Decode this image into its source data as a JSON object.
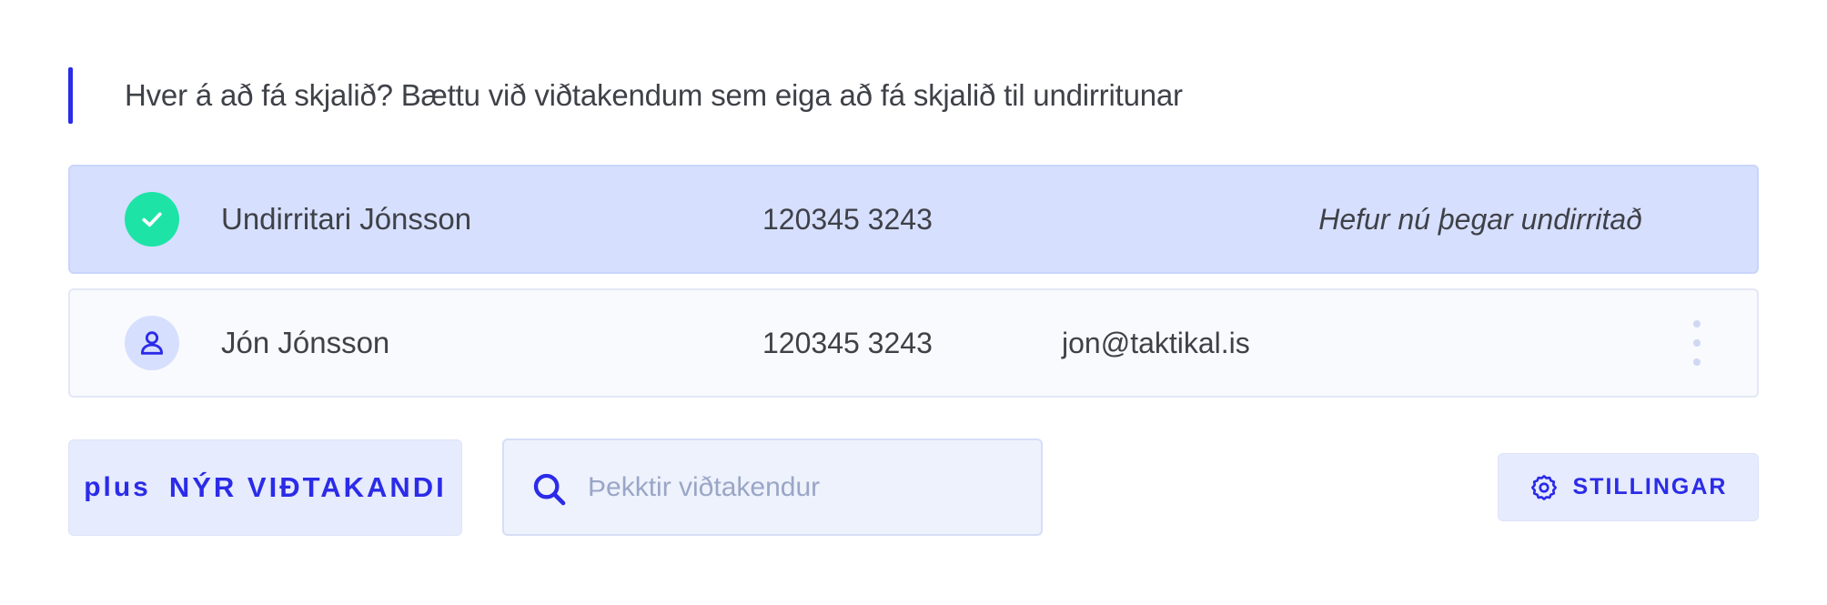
{
  "intro": {
    "text": "Hver á að fá skjalið? Bættu við viðtakendum sem eiga að fá skjalið til undirritunar"
  },
  "recipients": [
    {
      "name": "Undirritari Jónsson",
      "ssn": "120345 3243",
      "status": "Hefur nú þegar undirritað",
      "icon": "check-icon",
      "signed": true
    },
    {
      "name": "Jón Jónsson",
      "ssn": "120345 3243",
      "email": "jon@taktikal.is",
      "icon": "user-icon",
      "signed": false
    }
  ],
  "actions": {
    "add_label": "NÝR VIÐTAKANDI",
    "add_icon": "plus",
    "search_placeholder": "Þekktir viðtakendur",
    "search_value": "",
    "settings_label": "STILLINGAR"
  },
  "colors": {
    "accent": "#2b2be8",
    "signed_row": "#d6dffd",
    "success": "#1de4a6",
    "text": "#3f4148"
  }
}
